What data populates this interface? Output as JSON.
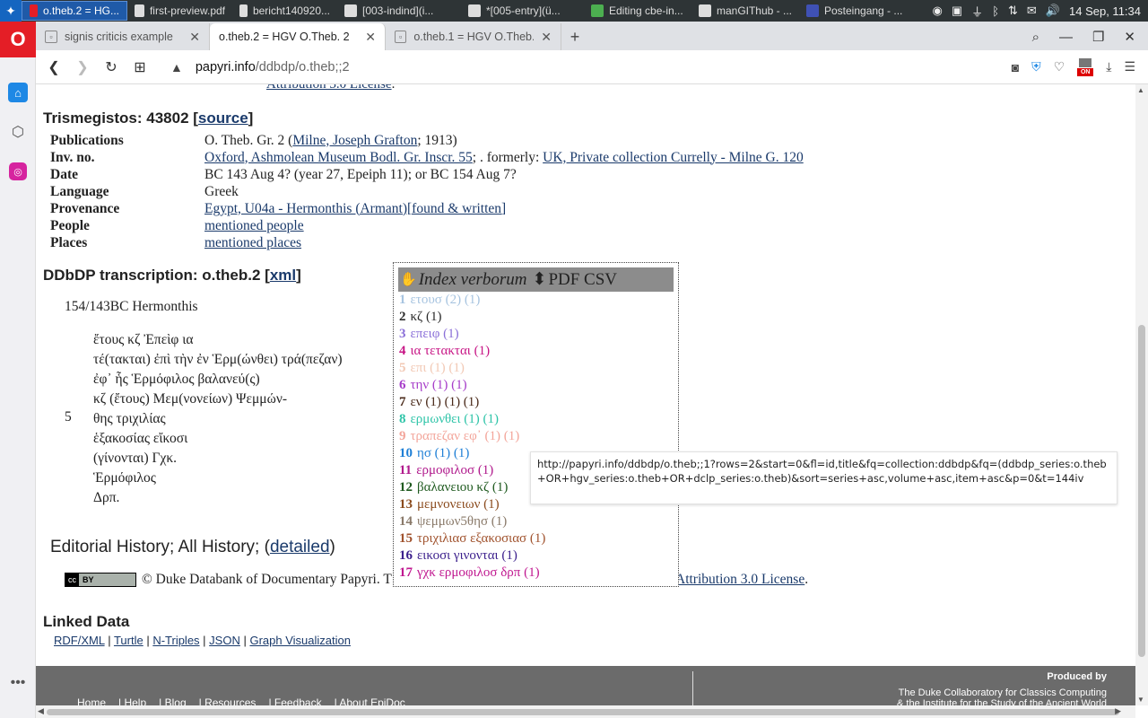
{
  "taskbar": {
    "tasks": [
      {
        "label": "o.theb.2 = HG...",
        "icon": "opera-icon",
        "active": true
      },
      {
        "label": "first-preview.pdf",
        "icon": "pdf-icon",
        "active": false
      },
      {
        "label": "bericht140920...",
        "icon": "document-icon",
        "active": false
      },
      {
        "label": "[003-indind](i...",
        "icon": "window-icon",
        "active": false
      },
      {
        "label": "*[005-entry](ü...",
        "icon": "editor-icon",
        "active": false
      },
      {
        "label": "Editing cbe-in...",
        "icon": "chrome-icon",
        "active": false
      },
      {
        "label": "manGIThub - ...",
        "icon": "folder-icon",
        "active": false
      },
      {
        "label": "Posteingang - ...",
        "icon": "mail-icon",
        "active": false
      }
    ],
    "clock": "14 Sep, 11:34"
  },
  "tabs": [
    {
      "title": "signis criticis example",
      "active": false
    },
    {
      "title": "o.theb.2 = HGV O.Theb. 2",
      "active": true
    },
    {
      "title": "o.theb.1 = HGV O.Theb. 1",
      "active": false
    }
  ],
  "address": {
    "host": "papyri.info",
    "path": "/ddbdp/o.theb;;2"
  },
  "page": {
    "top_license": "Attribution 3.0 License",
    "trismegistos_label": "Trismegistos: 43802 [",
    "trismegistos_link": "source",
    "trismegistos_close": "]",
    "meta": [
      {
        "key": "Publications",
        "parts": [
          {
            "t": "O. Theb. Gr. 2 ("
          },
          {
            "t": "Milne, Joseph Grafton",
            "link": true
          },
          {
            "t": "; 1913)"
          }
        ]
      },
      {
        "key": "Inv. no.",
        "parts": [
          {
            "t": "Oxford, Ashmolean Museum Bodl. Gr. Inscr. 55",
            "link": true
          },
          {
            "t": "; . formerly: "
          },
          {
            "t": "UK, Private collection Currelly - Milne G. 120",
            "link": true
          }
        ]
      },
      {
        "key": "Date",
        "parts": [
          {
            "t": "BC 143 Aug 4? (year 27, Epeiph 11); or BC 154 Aug 7?"
          }
        ]
      },
      {
        "key": "Language",
        "parts": [
          {
            "t": "Greek"
          }
        ]
      },
      {
        "key": "Provenance",
        "parts": [
          {
            "t": "Egypt, U04a - Hermonthis (Armant)",
            "link": true
          },
          {
            "t": "[found & written]",
            "link": true
          }
        ]
      },
      {
        "key": "People",
        "parts": [
          {
            "t": "mentioned people",
            "link": true
          }
        ]
      },
      {
        "key": "Places",
        "parts": [
          {
            "t": "mentioned places",
            "link": true
          }
        ]
      }
    ],
    "ddbdp_label": "DDbDP transcription: o.theb.2 [",
    "ddbdp_link": "xml",
    "ddbdp_close": "]",
    "subtitle": "154/143BC Hermonthis",
    "lines": [
      "ἔτους κζ Ἐπεὶφ ια",
      "τέ(τακται) ἐπὶ τὴν ἐν Ἑρμ(ώνθει) τρά(πεζαν)",
      "ἐφ᾽ ἧς Ἑρμόφιλος βαλανεύ(ς)",
      "κζ (ἔτους) Μεμ(νονείων) Ψεμμών-",
      "θης τριχιλίας",
      "ἑξακοσίας εἴκοσι",
      "(γίνονται) Γχκ.",
      "Ἑρμόφιλος",
      "Δρπ."
    ],
    "line_number": "5",
    "edhist_prefix": "Editorial History; All History; (",
    "edhist_link": "detailed",
    "edhist_suffix": ")",
    "cc_badge_left": "cc",
    "cc_badge_right": "BY",
    "cc_text": "© Duke Databank of Documentary Papyri. T",
    "cc_tail_link": "Attribution 3.0 License",
    "cc_tail_dot": ".",
    "linked_heading": "Linked Data",
    "linked_links": [
      "RDF/XML",
      "Turtle",
      "N-Triples",
      "JSON",
      "Graph Visualization"
    ],
    "linked_sep": " | "
  },
  "footer": {
    "produced_by": "Produced by",
    "org_line1": "The Duke Collaboratory for Classics Computing",
    "org_line2": "& the Institute for the Study of the Ancient World",
    "nav": [
      "Home",
      "| Help",
      "| Blog",
      "| Resources",
      "| Feedback",
      "| About EpiDoc"
    ]
  },
  "index": {
    "title_italic": "Index verborum",
    "title_rest": "PDF CSV",
    "items": [
      {
        "num": "1",
        "text": "ετουσ (2) (1)",
        "color": "#a7c4e0"
      },
      {
        "num": "2",
        "text": "κζ (1)",
        "color": "#2b2b2b"
      },
      {
        "num": "3",
        "text": "επειφ (1)",
        "color": "#8a6fd8"
      },
      {
        "num": "4",
        "text": "ια τετακται (1)",
        "color": "#c71585"
      },
      {
        "num": "5",
        "text": "επι (1) (1)",
        "color": "#f2c9b5"
      },
      {
        "num": "6",
        "text": "την (1) (1)",
        "color": "#a63cc9"
      },
      {
        "num": "7",
        "text": "εν (1) (1) (1)",
        "color": "#4a2a1a"
      },
      {
        "num": "8",
        "text": "ερμωνθει (1) (1)",
        "color": "#2ec4a8"
      },
      {
        "num": "9",
        "text": "τραπεζαν εφ᾽ (1) (1)",
        "color": "#f3a59a"
      },
      {
        "num": "10",
        "text": "ησ (1) (1)",
        "color": "#1e7fd6"
      },
      {
        "num": "11",
        "text": "ερμοφιλοσ (1)",
        "color": "#b0198c"
      },
      {
        "num": "12",
        "text": "βαλανειου κζ (1)",
        "color": "#1f5a1f"
      },
      {
        "num": "13",
        "text": "μεμνονειων (1)",
        "color": "#8a4a1c"
      },
      {
        "num": "14",
        "text": "ψεμμων5θησ (1)",
        "color": "#8a7a6a"
      },
      {
        "num": "15",
        "text": "τριχιλιασ εξακοσιασ (1)",
        "color": "#a0522d"
      },
      {
        "num": "16",
        "text": "εικοσι γινονται (1)",
        "color": "#3b1f8c"
      },
      {
        "num": "17",
        "text": "γχκ ερμοφιλοσ δρπ (1)",
        "color": "#c01890"
      }
    ]
  },
  "tooltip": {
    "text": "http://papyri.info/ddbdp/o.theb;;1?rows=2&start=0&fl=id,title&fq=collection:ddbdp&fq=(ddbdp_series:o.theb+OR+hgv_series:o.theb+OR+dclp_series:o.theb)&sort=series+asc,volume+asc,item+asc&p=0&t=144iv"
  }
}
